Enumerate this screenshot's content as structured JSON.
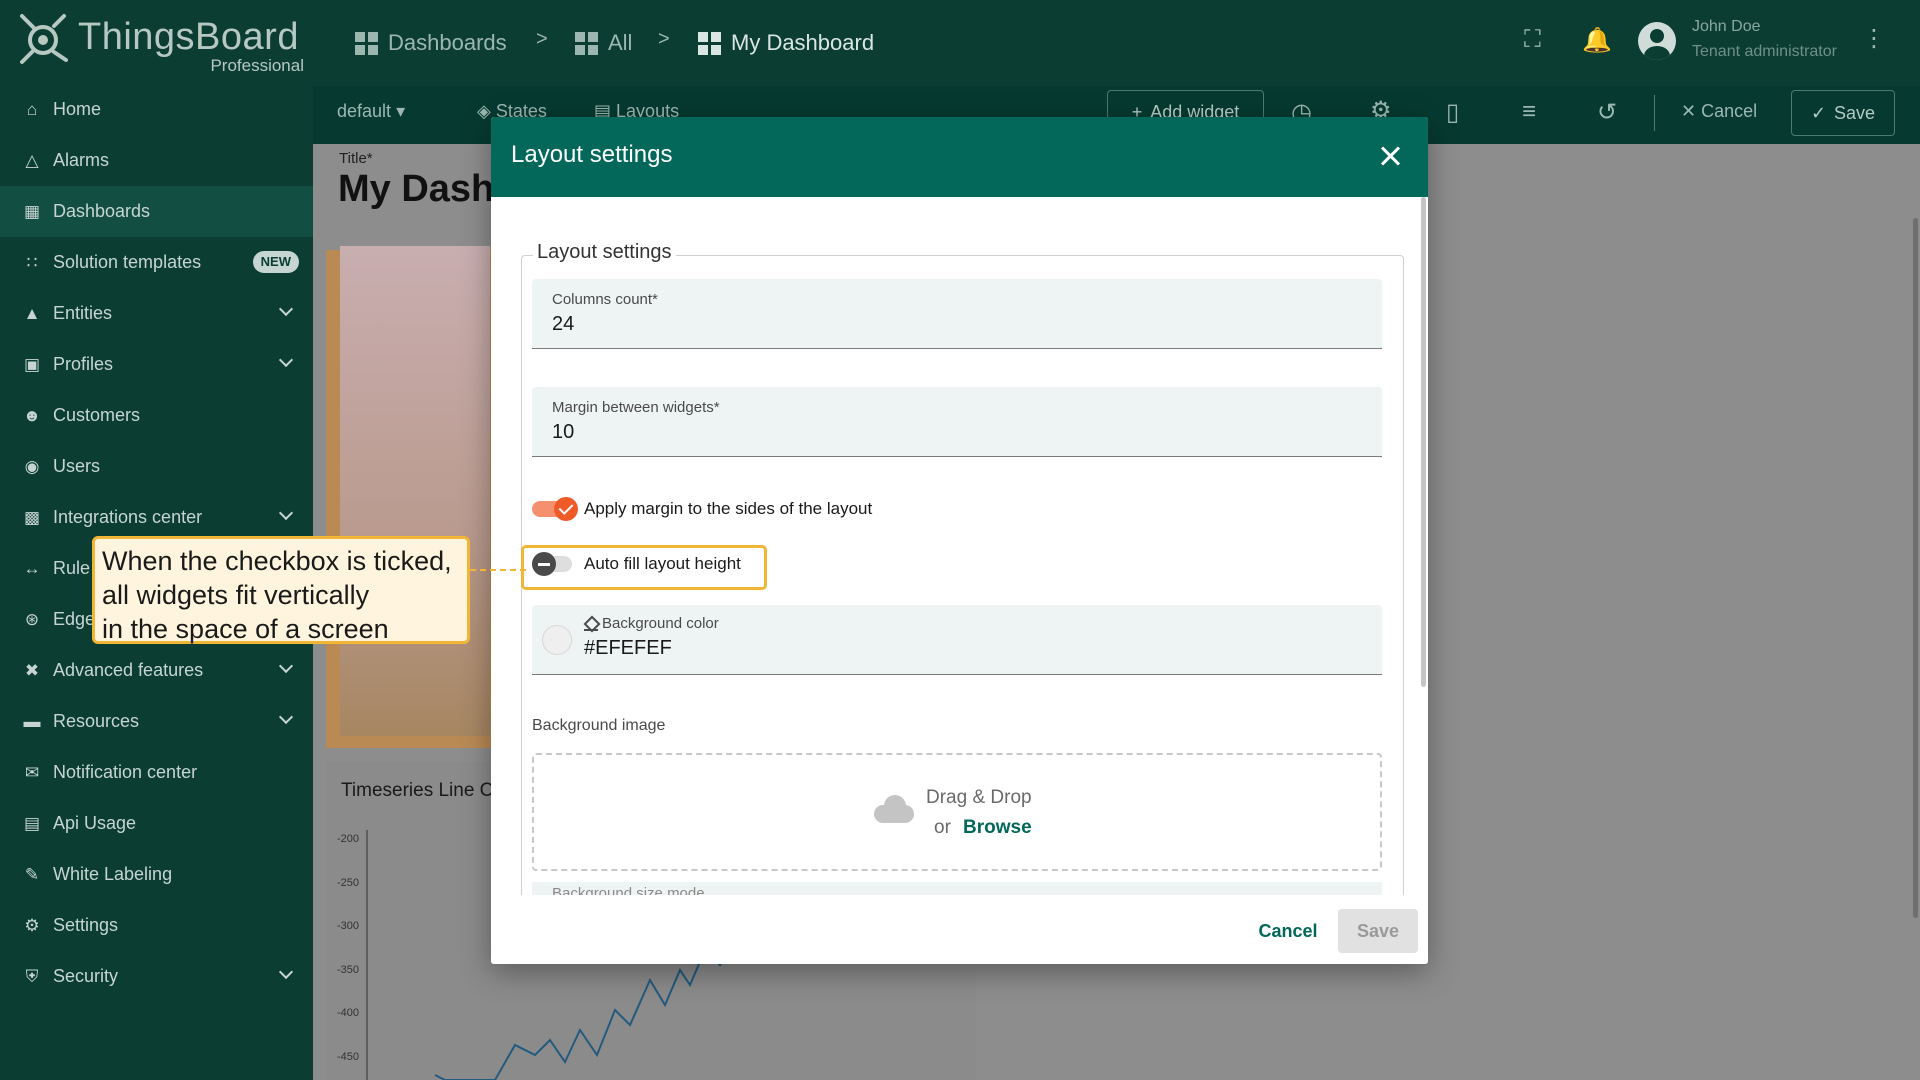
{
  "app": {
    "logo_text": "ThingsBoard",
    "logo_sub": "Professional"
  },
  "breadcrumb": {
    "items": [
      "Dashboards",
      "All",
      "My Dashboard"
    ],
    "separator": ">"
  },
  "user": {
    "name": "John Doe",
    "role": "Tenant administrator"
  },
  "toolbar": {
    "state_select": "default",
    "states_label": "States",
    "layouts_label": "Layouts",
    "add_widget_label": "Add widget",
    "cancel_label": "Cancel",
    "save_label": "Save"
  },
  "sidebar": {
    "items": [
      {
        "label": "Home",
        "icon": "home-icon",
        "expandable": false
      },
      {
        "label": "Alarms",
        "icon": "warning-icon",
        "expandable": false
      },
      {
        "label": "Dashboards",
        "icon": "dashboard-icon",
        "expandable": false,
        "active": true
      },
      {
        "label": "Solution templates",
        "icon": "apps-icon",
        "expandable": false,
        "badge": "NEW"
      },
      {
        "label": "Entities",
        "icon": "entities-icon",
        "expandable": true
      },
      {
        "label": "Profiles",
        "icon": "profiles-icon",
        "expandable": true
      },
      {
        "label": "Customers",
        "icon": "customers-icon",
        "expandable": false
      },
      {
        "label": "Users",
        "icon": "user-icon",
        "expandable": false
      },
      {
        "label": "Integrations center",
        "icon": "integrations-icon",
        "expandable": true
      },
      {
        "label": "Rule",
        "icon": "code-icon",
        "expandable": false
      },
      {
        "label": "Edge",
        "icon": "edge-icon",
        "expandable": false
      },
      {
        "label": "Advanced features",
        "icon": "tools-icon",
        "expandable": true
      },
      {
        "label": "Resources",
        "icon": "folder-icon",
        "expandable": true
      },
      {
        "label": "Notification center",
        "icon": "notification-icon",
        "expandable": false
      },
      {
        "label": "Api Usage",
        "icon": "chart-icon",
        "expandable": false
      },
      {
        "label": "White Labeling",
        "icon": "brush-icon",
        "expandable": false
      },
      {
        "label": "Settings",
        "icon": "gear-icon",
        "expandable": false
      },
      {
        "label": "Security",
        "icon": "shield-icon",
        "expandable": true
      }
    ]
  },
  "background": {
    "title_label": "Title*",
    "title_partial": "My Dash",
    "chart_title_partial": "Timeseries Line C",
    "chart_ticks": [
      "-200",
      "-250",
      "-300",
      "-350",
      "-400",
      "-450"
    ]
  },
  "dialog": {
    "title": "Layout settings",
    "section_legend": "Layout settings",
    "columns_count": {
      "label": "Columns count*",
      "value": "24"
    },
    "margin": {
      "label": "Margin between widgets*",
      "value": "10"
    },
    "apply_margin": {
      "label": "Apply margin to the sides of the layout",
      "checked": true
    },
    "auto_fill": {
      "label": "Auto fill layout height",
      "checked": false
    },
    "background_color": {
      "label": "Background color",
      "value": "#EFEFEF"
    },
    "background_image": {
      "label": "Background image",
      "drop_text": "Drag & Drop",
      "or_text": "or",
      "browse_text": "Browse"
    },
    "next_field_partial": "Background size mode",
    "cancel_label": "Cancel",
    "save_label": "Save"
  },
  "callout": {
    "lines": [
      "When the checkbox is ticked,",
      "all widgets fit vertically",
      "in the space of a screen"
    ]
  },
  "colors": {
    "sidebar_bg": "#0b3d33",
    "dialog_header": "#03685a",
    "accent_orange": "#f05a28",
    "highlight": "#f2b637"
  }
}
